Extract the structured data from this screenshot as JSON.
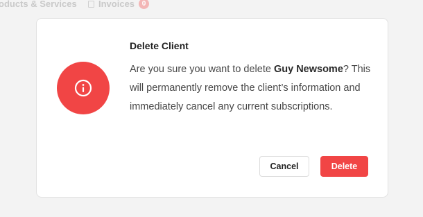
{
  "background_nav": {
    "products_tab_label": "oducts & Services",
    "invoices_tab_label": "Invoices",
    "invoices_badge": "0"
  },
  "dialog": {
    "title": "Delete Client",
    "body_prefix": "Are you sure you want to delete ",
    "client_name": "Guy Newsome",
    "body_suffix": "? This will permanently remove the client’s information and immediately cancel any current subscriptions.",
    "cancel_label": "Cancel",
    "delete_label": "Delete",
    "icon": "info-icon"
  },
  "colors": {
    "danger": "#f14545",
    "backdrop": "#f3f3f3"
  }
}
